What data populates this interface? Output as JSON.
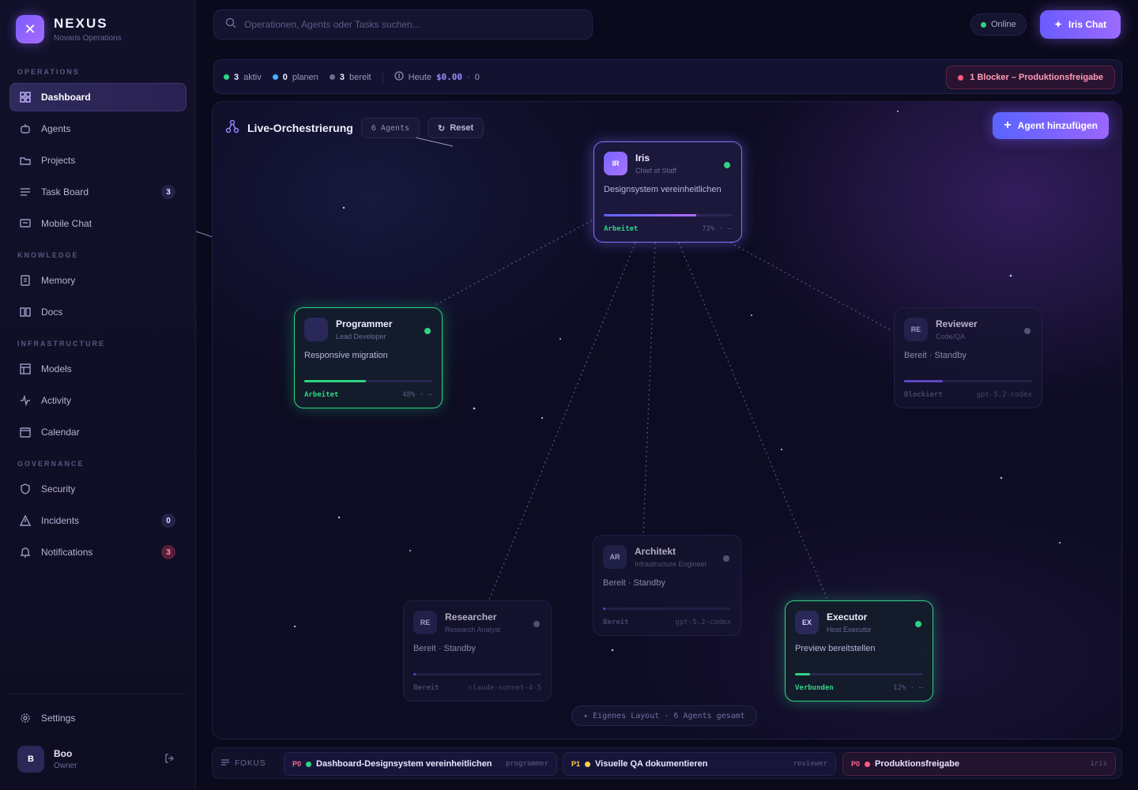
{
  "brand": {
    "name": "NEXUS",
    "subtitle": "Novaris Operations"
  },
  "nav": {
    "sections": [
      "OPERATIONS",
      "KNOWLEDGE",
      "INFRASTRUCTURE",
      "GOVERNANCE"
    ],
    "items": [
      {
        "label": "Dashboard",
        "icon": "dashboard-icon"
      },
      {
        "label": "Agents",
        "icon": "agents-icon"
      },
      {
        "label": "Projects",
        "icon": "projects-icon"
      },
      {
        "label": "Task Board",
        "icon": "taskboard-icon",
        "badge": "3"
      },
      {
        "label": "Mobile Chat",
        "icon": "chat-icon"
      },
      {
        "label": "Memory",
        "icon": "memory-icon"
      },
      {
        "label": "Docs",
        "icon": "docs-icon"
      },
      {
        "label": "Models",
        "icon": "models-icon"
      },
      {
        "label": "Activity",
        "icon": "activity-icon"
      },
      {
        "label": "Calendar",
        "icon": "calendar-icon"
      },
      {
        "label": "Security",
        "icon": "shield-icon"
      },
      {
        "label": "Incidents",
        "icon": "warning-icon",
        "badge": "0"
      },
      {
        "label": "Notifications",
        "icon": "bell-icon",
        "badge": "3"
      }
    ],
    "settings": "Settings"
  },
  "user": {
    "initials": "B",
    "name": "Boo",
    "role": "Owner"
  },
  "header": {
    "search_placeholder": "Operationen, Agents oder Tasks suchen...",
    "online": "Online",
    "iris_chat": "Iris Chat"
  },
  "status": {
    "active_count": "3",
    "active_label": "aktiv",
    "planning_count": "0",
    "planning_label": "planen",
    "ready_count": "3",
    "ready_label": "bereit",
    "today_label": "Heute",
    "today_value": "$0.00",
    "today_extra": "0",
    "blocker": "1 Blocker – Produktionsfreigabe"
  },
  "canvas": {
    "title": "Live-Orchestrierung",
    "agent_count": "6 Agents",
    "reset": "Reset",
    "add_agent": "Agent hinzufügen",
    "layout_info": "Eigenes Layout · 6 Agents gesamt"
  },
  "agents": [
    {
      "initials": "IR",
      "name": "Iris",
      "role": "Chief of Staff",
      "task": "Designsystem vereinheitlichen",
      "state": "Arbeitet",
      "meta": "72% · —",
      "progress": 0.72,
      "status_color": "#2fd383",
      "bar_color": "#7c5cff"
    },
    {
      "initials": "",
      "name": "Programmer",
      "role": "Lead Developer",
      "task": "Responsive migration",
      "state": "Arbeitet",
      "meta": "48% · —",
      "progress": 0.48,
      "status_color": "#2fd383",
      "bar_color": "#2fd383"
    },
    {
      "initials": "RE",
      "name": "Reviewer",
      "role": "Code/QA",
      "task": "Bereit · Standby",
      "state": "Blockiert",
      "meta": "gpt-5.2-codex",
      "progress": 0.3,
      "status_color": "#6e6b93",
      "bar_color": "#7c5cff"
    },
    {
      "initials": "AR",
      "name": "Architekt",
      "role": "Infrastructure Engineer",
      "task": "Bereit · Standby",
      "state": "Bereit",
      "meta": "gpt-5.2-codex",
      "progress": 0.02,
      "status_color": "#6e6b93",
      "bar_color": "#7c5cff"
    },
    {
      "initials": "RE",
      "name": "Researcher",
      "role": "Research Analyst",
      "task": "Bereit · Standby",
      "state": "Bereit",
      "meta": "claude-sonnet-4-5",
      "progress": 0.02,
      "status_color": "#6e6b93",
      "bar_color": "#7c5cff"
    },
    {
      "initials": "EX",
      "name": "Executor",
      "role": "Host Executor",
      "task": "Preview bereitstellen",
      "state": "Verbunden",
      "meta": "12% · —",
      "progress": 0.12,
      "status_color": "#2fd383",
      "bar_color": "#2fd383"
    }
  ],
  "focus": {
    "label": "FOKUS",
    "items": [
      {
        "prio": "P0",
        "prio_color": "#ff6b9a",
        "dot": "#2fd383",
        "title": "Dashboard-Designsystem vereinheitlichen",
        "owner": "programmer"
      },
      {
        "prio": "P1",
        "prio_color": "#ffd24a",
        "dot": "#ffd24a",
        "title": "Visuelle QA dokumentieren",
        "owner": "reviewer"
      },
      {
        "prio": "P0",
        "prio_color": "#ff6b9a",
        "dot": "#ff5c7a",
        "title": "Produktionsfreigabe",
        "owner": "iris"
      }
    ]
  }
}
